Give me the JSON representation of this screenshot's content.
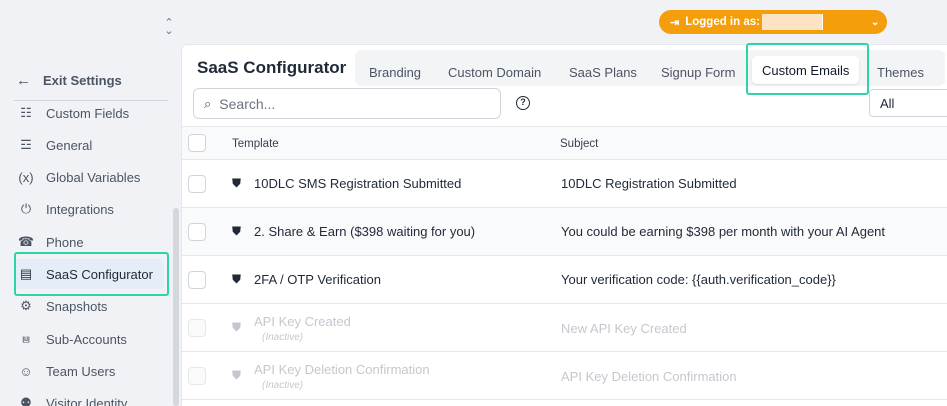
{
  "header": {
    "logged_in_label": "Logged in as:"
  },
  "sidebar": {
    "exit_label": "Exit Settings",
    "items": [
      {
        "label": "Custom Fields",
        "icon": "custom-fields-icon"
      },
      {
        "label": "General",
        "icon": "sliders-icon"
      },
      {
        "label": "Global Variables",
        "icon": "variable-icon"
      },
      {
        "label": "Integrations",
        "icon": "plug-icon"
      },
      {
        "label": "Phone",
        "icon": "phone-icon"
      },
      {
        "label": "SaaS Configurator",
        "icon": "layout-icon",
        "active": true
      },
      {
        "label": "Snapshots",
        "icon": "gear-icon"
      },
      {
        "label": "Sub-Accounts",
        "icon": "sitemap-icon"
      },
      {
        "label": "Team Users",
        "icon": "users-icon"
      },
      {
        "label": "Visitor Identity",
        "icon": "user-search-icon"
      }
    ]
  },
  "main": {
    "title": "SaaS Configurator",
    "tabs": [
      {
        "label": "Branding"
      },
      {
        "label": "Custom Domain"
      },
      {
        "label": "SaaS Plans"
      },
      {
        "label": "Signup Form"
      },
      {
        "label": "Custom Emails",
        "active": true
      },
      {
        "label": "Themes"
      }
    ],
    "search_placeholder": "Search...",
    "filter_value": "All",
    "table": {
      "columns": [
        "Template",
        "Subject"
      ],
      "rows": [
        {
          "template": "10DLC SMS Registration Submitted",
          "subject": "10DLC Registration Submitted",
          "inactive": false
        },
        {
          "template": "2. Share & Earn ($398 waiting for you)",
          "subject": "You could be earning $398 per month with your AI Agent",
          "inactive": false
        },
        {
          "template": "2FA / OTP Verification",
          "subject": "Your verification code: {{auth.verification_code}}",
          "inactive": false
        },
        {
          "template": "API Key Created",
          "subject": "New API Key Created",
          "inactive": true,
          "status": "(Inactive)"
        },
        {
          "template": "API Key Deletion Confirmation",
          "subject": "API Key Deletion Confirmation",
          "inactive": true,
          "status": "(Inactive)"
        }
      ]
    }
  },
  "colors": {
    "accent": "#f59e0b",
    "highlight": "#2dd4a7",
    "active_nav_bg": "#e5edf9"
  }
}
